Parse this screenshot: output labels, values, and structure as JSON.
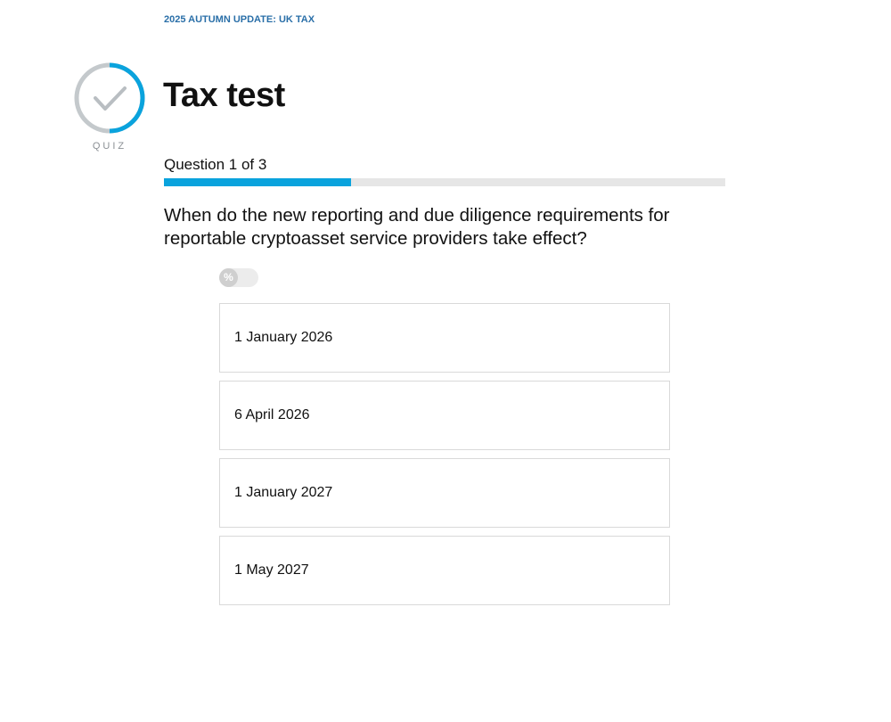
{
  "header": {
    "breadcrumb": "2025 AUTUMN UPDATE: UK TAX"
  },
  "badge": {
    "icon": "check-circle-icon",
    "caption": "QUIZ",
    "ring_color": "#0aa3dd",
    "ring_track_color": "#c4c9cc"
  },
  "title": "Tax test",
  "progress": {
    "label": "Question 1 of 3",
    "current": 1,
    "total": 3,
    "fraction": 0.333,
    "fill_color": "#0aa3dd"
  },
  "question": {
    "text": "When do the new reporting and due diligence requirements for reportable cryptoasset service providers take effect?"
  },
  "percent_toggle": {
    "symbol": "%"
  },
  "answers": [
    {
      "label": "1 January 2026"
    },
    {
      "label": "6 April 2026"
    },
    {
      "label": "1 January 2027"
    },
    {
      "label": "1 May 2027"
    }
  ]
}
